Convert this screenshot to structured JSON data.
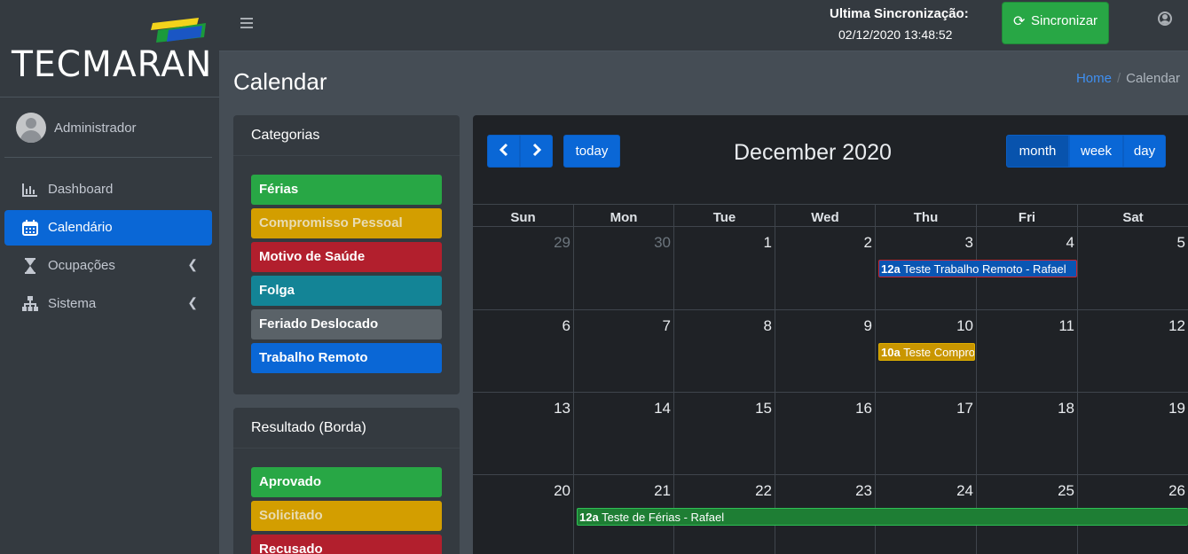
{
  "brand": {
    "name": "TECMARAN"
  },
  "sidebar": {
    "user": "Administrador",
    "items": [
      {
        "label": "Dashboard",
        "icon": "chart-bar-icon"
      },
      {
        "label": "Calendário",
        "icon": "calendar-icon"
      },
      {
        "label": "Ocupações",
        "icon": "hourglass-icon"
      },
      {
        "label": "Sistema",
        "icon": "sitemap-icon"
      }
    ]
  },
  "header": {
    "sync_title": "Ultima Sincronização:",
    "sync_date": "02/12/2020 13:48:52",
    "sync_button": "Sincronizar"
  },
  "page": {
    "title": "Calendar",
    "breadcrumb": {
      "home": "Home",
      "current": "Calendar"
    }
  },
  "categories": {
    "title": "Categorias",
    "items": [
      {
        "label": "Férias",
        "color": "#28a745"
      },
      {
        "label": "Compromisso Pessoal",
        "color": "#d39e00"
      },
      {
        "label": "Motivo de Saúde",
        "color": "#c82333"
      },
      {
        "label": "Folga",
        "color": "#17a2b8"
      },
      {
        "label": "Feriado Deslocado",
        "color": "#6c757d"
      },
      {
        "label": "Trabalho Remoto",
        "color": "#0a67d6"
      }
    ]
  },
  "results": {
    "title": "Resultado (Borda)",
    "items": [
      {
        "label": "Aprovado",
        "color": "#28a745"
      },
      {
        "label": "Solicitado",
        "color": "#d39e00"
      },
      {
        "label": "Recusado",
        "color": "#c82333"
      }
    ]
  },
  "calendar": {
    "title": "December 2020",
    "today_label": "today",
    "views": {
      "month": "month",
      "week": "week",
      "day": "day"
    },
    "weekdays": [
      "Sun",
      "Mon",
      "Tue",
      "Wed",
      "Thu",
      "Fri",
      "Sat"
    ],
    "weeks": [
      [
        "29",
        "30",
        "1",
        "2",
        "3",
        "4",
        "5"
      ],
      [
        "6",
        "7",
        "8",
        "9",
        "10",
        "11",
        "12"
      ],
      [
        "13",
        "14",
        "15",
        "16",
        "17",
        "18",
        "19"
      ],
      [
        "20",
        "21",
        "22",
        "23",
        "24",
        "25",
        "26"
      ]
    ],
    "events": [
      {
        "time": "12a",
        "title": "Teste Trabalho Remoto - Rafael"
      },
      {
        "time": "10a",
        "title": "Teste Compromisso"
      },
      {
        "time": "12a",
        "title": "Teste de Férias - Rafael"
      }
    ]
  }
}
